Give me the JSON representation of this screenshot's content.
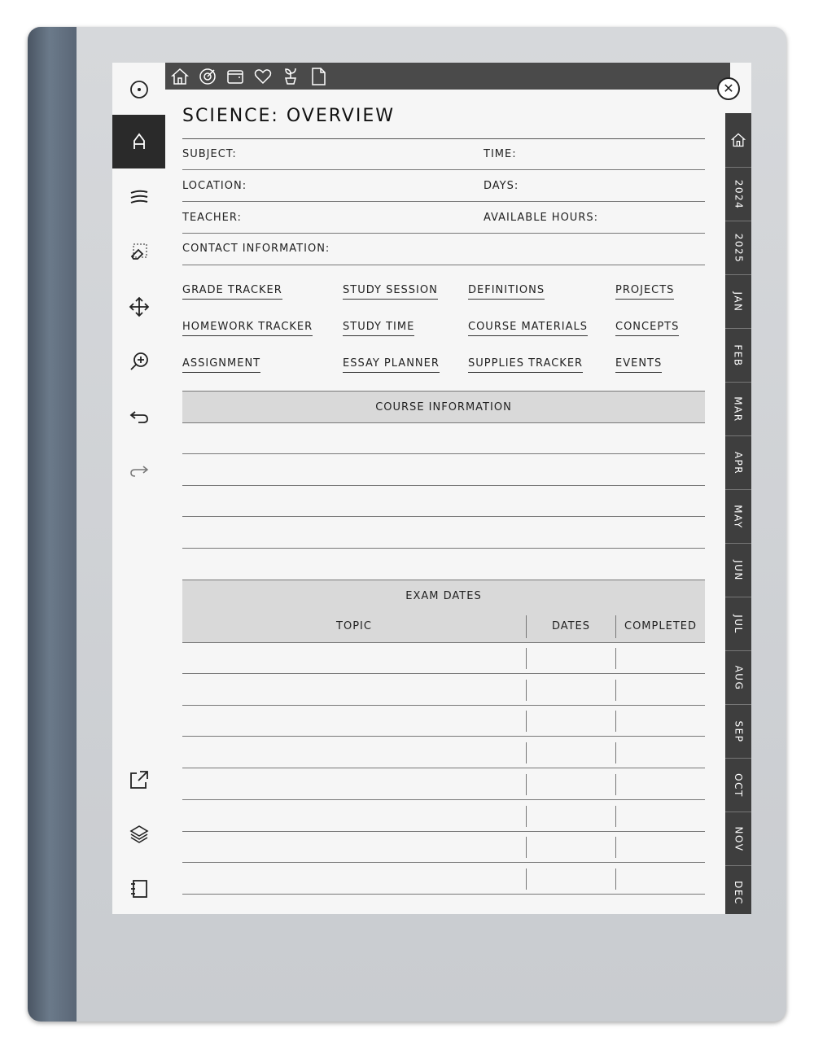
{
  "header": {
    "title": "SCIENCE: OVERVIEW",
    "topbar_icons": [
      "home-icon",
      "gauge-icon",
      "wallet-icon",
      "heart-icon",
      "plant-icon",
      "document-icon"
    ]
  },
  "info": {
    "subject": "SUBJECT:",
    "time": "TIME:",
    "location": "LOCATION:",
    "days": "DAYS:",
    "teacher": "TEACHER:",
    "available_hours": "AVAILABLE HOURS:",
    "contact": "CONTACT INFORMATION:"
  },
  "links": [
    "GRADE TRACKER",
    "STUDY SESSION",
    "DEFINITIONS",
    "PROJECTS",
    "HOMEWORK TRACKER",
    "STUDY TIME",
    "COURSE MATERIALS",
    "CONCEPTS",
    "ASSIGNMENT",
    "ESSAY PLANNER",
    "SUPPLIES TRACKER",
    "EVENTS"
  ],
  "course_info": {
    "title": "COURSE INFORMATION"
  },
  "exam": {
    "title": "EXAM DATES",
    "col_topic": "TOPIC",
    "col_dates": "DATES",
    "col_completed": "COMPLETED"
  },
  "side_tabs": [
    "2024",
    "2025",
    "JAN",
    "FEB",
    "MAR",
    "APR",
    "MAY",
    "JUN",
    "JUL",
    "AUG",
    "SEP",
    "OCT",
    "NOV",
    "DEC"
  ],
  "toolbar_tools": [
    "power-icon",
    "pen-icon",
    "menu-lines-icon",
    "eraser-icon",
    "move-icon",
    "zoom-icon",
    "undo-icon",
    "redo-icon",
    "share-icon",
    "layers-icon",
    "notebook-icon"
  ],
  "close_label": "✕"
}
